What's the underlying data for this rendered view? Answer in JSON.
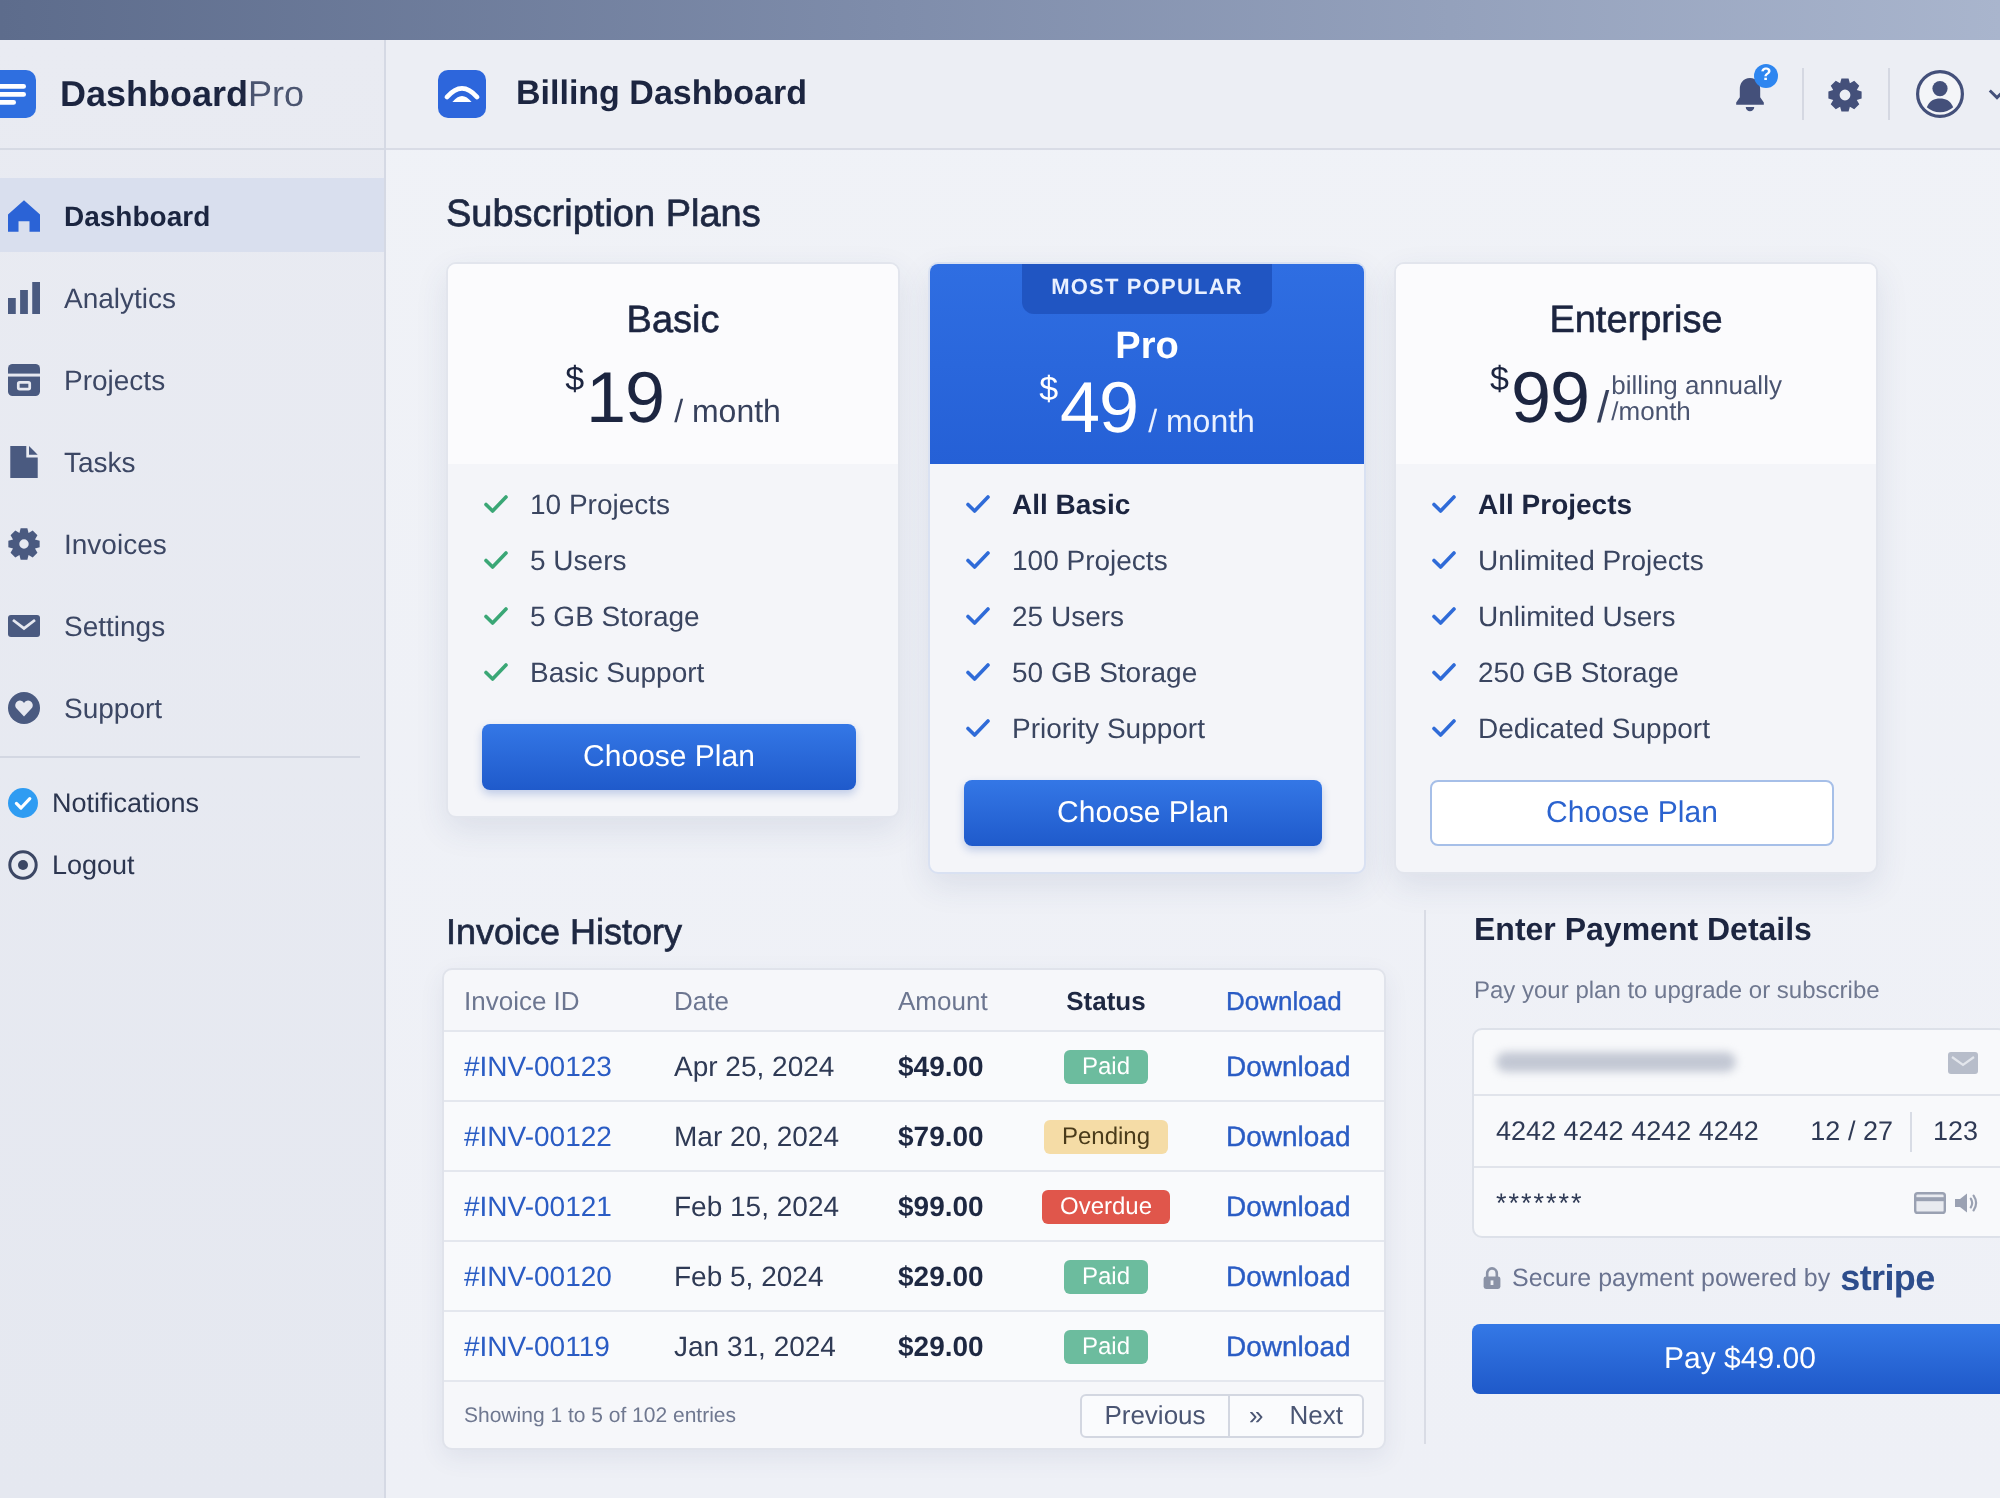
{
  "sidebar": {
    "logo": "**Dashboard**Pro",
    "items": [
      {
        "label": "Dashboard",
        "selected": true
      },
      {
        "label": "Analytics",
        "selected": false
      },
      {
        "label": "Projects",
        "selected": false
      },
      {
        "label": "Tasks",
        "selected": false
      },
      {
        "label": "Invoices",
        "selected": false
      },
      {
        "label": "Settings",
        "selected": false
      },
      {
        "label": "Support",
        "selected": false
      }
    ],
    "footer_items": [
      {
        "label": "Notifications"
      },
      {
        "label": "Logout"
      }
    ]
  },
  "header": {
    "title": "Billing Dashboard",
    "notification_badge": "?"
  },
  "plans": {
    "title": "Subscription Plans",
    "cards": [
      {
        "name": "Basic",
        "featured": false,
        "color": "#3aa776",
        "price": {
          "currency": "$",
          "amount": "19",
          "period": "/ month"
        },
        "features": [
          {
            "text": "10 Projects",
            "bold": false
          },
          {
            "text": "5 Users",
            "bold": false
          },
          {
            "text": "5 GB Storage",
            "bold": false
          },
          {
            "text": "Basic Support",
            "bold": false
          }
        ],
        "button": {
          "label": "Choose Plan",
          "kind": "primary"
        }
      },
      {
        "name": "Pro",
        "featured": true,
        "badge": "MOST POPULAR",
        "color": "#2f6bd8",
        "price": {
          "currency": "$",
          "amount": "49",
          "period": "/ month"
        },
        "features": [
          {
            "text": "All Basic",
            "bold": true
          },
          {
            "text": "100 Projects",
            "bold": false
          },
          {
            "text": "25 Users",
            "bold": false
          },
          {
            "text": "50 GB Storage",
            "bold": false
          },
          {
            "text": "Priority Support",
            "bold": false
          }
        ],
        "button": {
          "label": "Choose Plan",
          "kind": "primary"
        }
      },
      {
        "name": "Enterprise",
        "featured": false,
        "color": "#2f6bd8",
        "price": {
          "currency": "$",
          "amount": "99",
          "separator": "/",
          "note": "billing annually",
          "period": "/month"
        },
        "features": [
          {
            "text": "All Projects",
            "bold": true
          },
          {
            "text": "Unlimited Projects",
            "bold": false
          },
          {
            "text": "Unlimited Users",
            "bold": false
          },
          {
            "text": "250 GB Storage",
            "bold": false
          },
          {
            "text": "Dedicated Support",
            "bold": false
          }
        ],
        "button": {
          "label": "Choose Plan",
          "kind": "secondary"
        }
      }
    ]
  },
  "invoices": {
    "title": "Invoice History",
    "columns": [
      "Invoice ID",
      "Date",
      "Amount",
      "Status",
      "Download"
    ],
    "rows": [
      {
        "id": "#INV-00123",
        "date": "Apr 25, 2024",
        "amount": "$49.00",
        "status": "Paid",
        "color": "#6cbc9e",
        "download": "Download"
      },
      {
        "id": "#INV-00122",
        "date": "Mar 20, 2024",
        "amount": "$79.00",
        "status": "Pending",
        "color": "#f5dca6",
        "download": "Download"
      },
      {
        "id": "#INV-00121",
        "date": "Feb 15, 2024",
        "amount": "$99.00",
        "status": "Overdue",
        "color": "#e0564b",
        "download": "Download"
      },
      {
        "id": "#INV-00120",
        "date": "Feb 5, 2024",
        "amount": "$29.00",
        "status": "Paid",
        "color": "#6cbc9e",
        "download": "Download"
      },
      {
        "id": "#INV-00119",
        "date": "Jan 31, 2024",
        "amount": "$29.00",
        "status": "Paid",
        "color": "#6cbc9e",
        "download": "Download"
      }
    ],
    "summary": "Showing 1 to 5 of 102 entries",
    "pagination": {
      "previous": "Previous",
      "next_icon": "»",
      "next": "Next"
    }
  },
  "payment": {
    "title": "Enter Payment Details",
    "subtitle": "Pay your plan to upgrade or subscribe",
    "card_number": "4242 4242 4242 4242",
    "expiry": "12 / 27",
    "cvc": "123",
    "password": "*******",
    "secure_text": "Secure payment powered by",
    "brand": "stripe",
    "pay_button": "Pay $49.00"
  }
}
